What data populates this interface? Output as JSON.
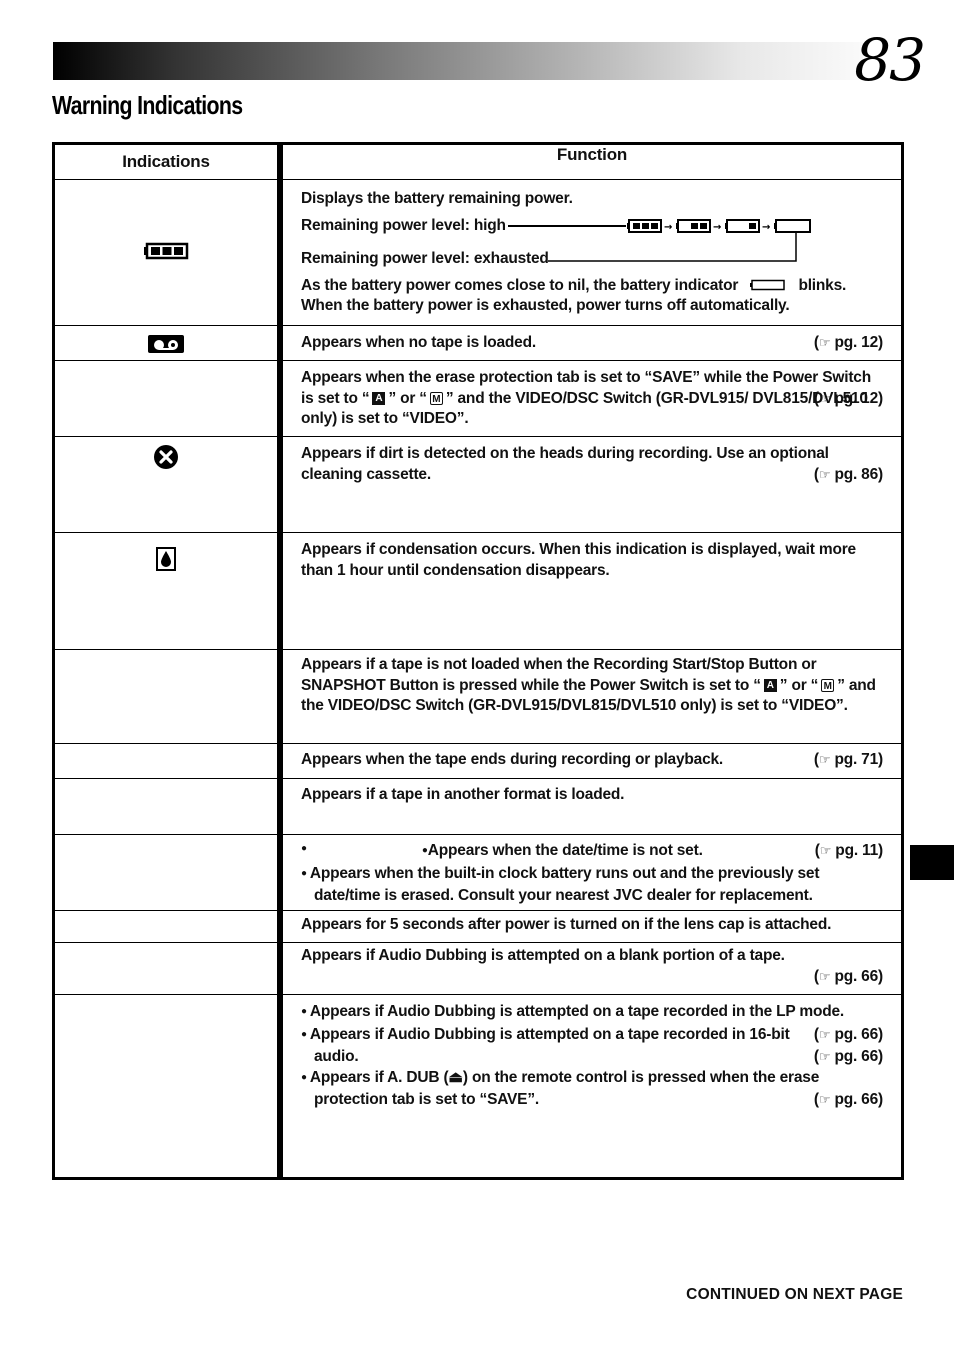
{
  "page": {
    "number": "83",
    "title": "Warning Indications",
    "footer": "CONTINUED ON NEXT PAGE"
  },
  "table": {
    "headers": {
      "indications": "Indications",
      "function": "Function"
    },
    "ref_glyph": "☞",
    "rows": [
      {
        "icon": "battery-full-icon",
        "lines": [
          "Displays the battery remaining power.",
          "Remaining power level: high",
          "Remaining power level: exhausted",
          "As the battery power comes close to nil, the battery indicator",
          "blinks.",
          "When the battery power is exhausted, power turns off automatically."
        ]
      },
      {
        "icon": "cassette-icon",
        "text": "Appears when no tape is loaded.",
        "ref": "pg. 12"
      },
      {
        "icon": "",
        "parts": [
          "Appears when the erase protection tab is set to “SAVE” while the Power Switch is set to “",
          "A",
          "” or “",
          "M",
          "” and the VIDEO/DSC Switch (GR-DVL915/ DVL815/DVL510 only) is set to “VIDEO”."
        ],
        "ref": "pg. 12"
      },
      {
        "icon": "head-clog-x-icon",
        "text": "Appears if dirt is detected on the heads during recording. Use an optional cleaning cassette.",
        "ref": "pg. 86"
      },
      {
        "icon": "condensation-drop-icon",
        "text": "Appears if condensation occurs. When this indication is displayed, wait more than 1 hour until condensation disappears."
      },
      {
        "icon": "",
        "parts": [
          "Appears if a tape is not loaded when the Recording Start/Stop Button or SNAPSHOT Button is pressed while the Power Switch is set to “",
          "A",
          "” or “",
          "M",
          "” and the VIDEO/DSC Switch (GR-DVL915/DVL815/DVL510 only) is set to “VIDEO”."
        ]
      },
      {
        "icon": "",
        "text": "Appears when the tape ends during recording or playback.",
        "ref": "pg. 71"
      },
      {
        "icon": "",
        "text": "Appears if a tape in another format is loaded."
      },
      {
        "icon": "",
        "bullets": [
          {
            "text": "Appears when the date/time is not set.",
            "ref": "pg. 11"
          },
          {
            "text": "Appears when the built-in clock battery runs out and the previously set date/time is erased. Consult your nearest JVC dealer for replacement."
          }
        ]
      },
      {
        "icon": "",
        "text": "Appears for 5 seconds after power is turned on if the lens cap is attached."
      },
      {
        "icon": "",
        "text": "Appears if Audio Dubbing is attempted on a blank portion of a tape.",
        "ref": "pg. 66"
      },
      {
        "icon": "",
        "bullets": [
          {
            "text": "Appears if Audio Dubbing is attempted on a tape recorded in the LP mode.",
            "ref": "pg. 66"
          },
          {
            "text": "Appears if Audio Dubbing is attempted on a tape recorded in 16-bit audio.",
            "ref": "pg. 66"
          },
          {
            "text": "Appears if A. DUB (⏏) on the remote control is pressed when the erase protection tab is set to “SAVE”.",
            "ref": "pg. 66"
          }
        ]
      }
    ]
  }
}
